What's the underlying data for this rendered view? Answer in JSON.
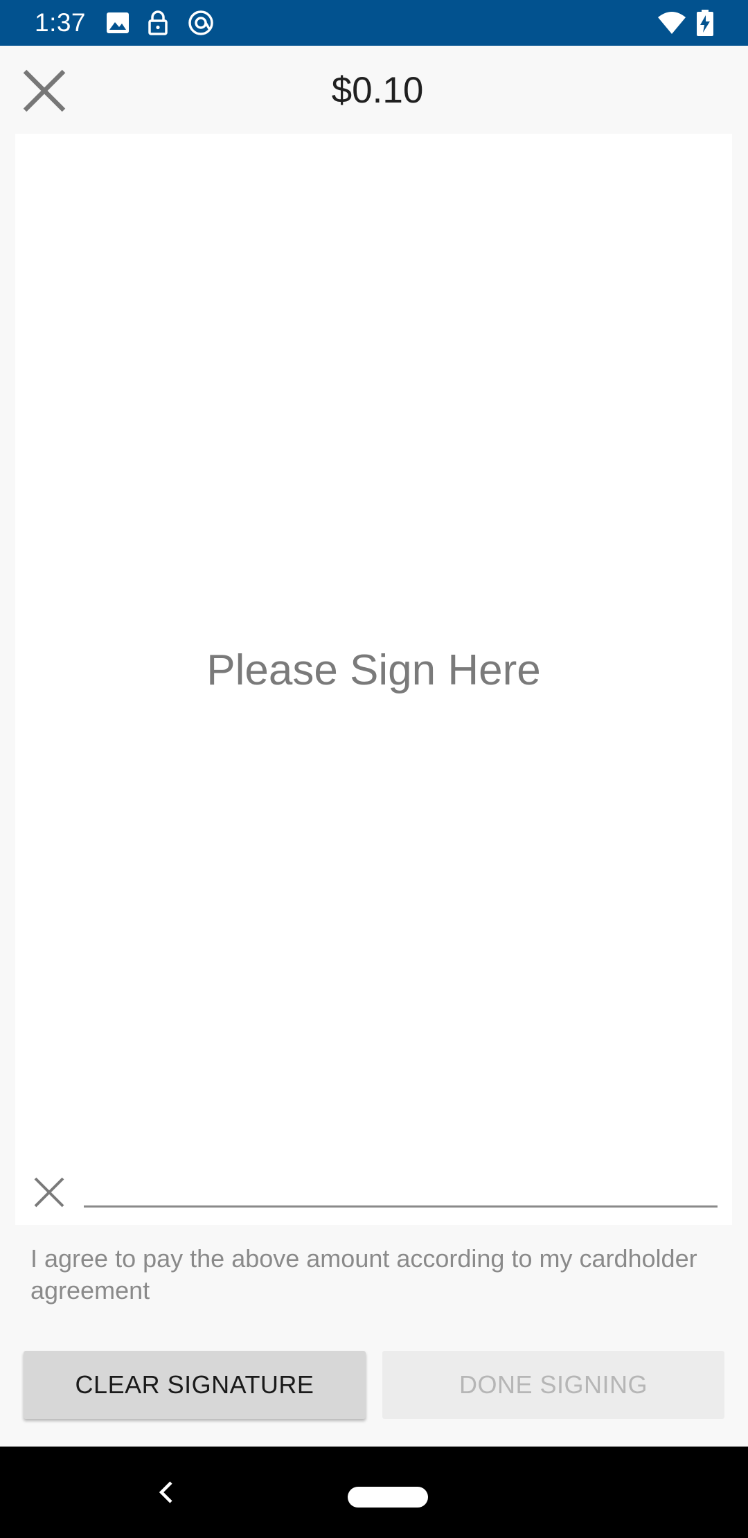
{
  "status_bar": {
    "time": "1:37",
    "icons_left": [
      "image-icon",
      "lock-icon",
      "at-sign-icon"
    ],
    "icons_right": [
      "wifi-icon",
      "battery-charging-icon"
    ],
    "background_color": "#02528f"
  },
  "header": {
    "amount": "$0.10",
    "close_icon": "close-icon"
  },
  "signature": {
    "placeholder": "Please Sign Here",
    "marker_icon": "x-mark-icon"
  },
  "agreement_text": "I agree to pay the above amount according to my cardholder agreement",
  "buttons": {
    "clear_label": "CLEAR SIGNATURE",
    "done_label": "DONE SIGNING",
    "done_enabled": false
  },
  "nav_bar": {
    "back_icon": "back-chevron-icon",
    "home_icon": "home-pill-icon"
  }
}
